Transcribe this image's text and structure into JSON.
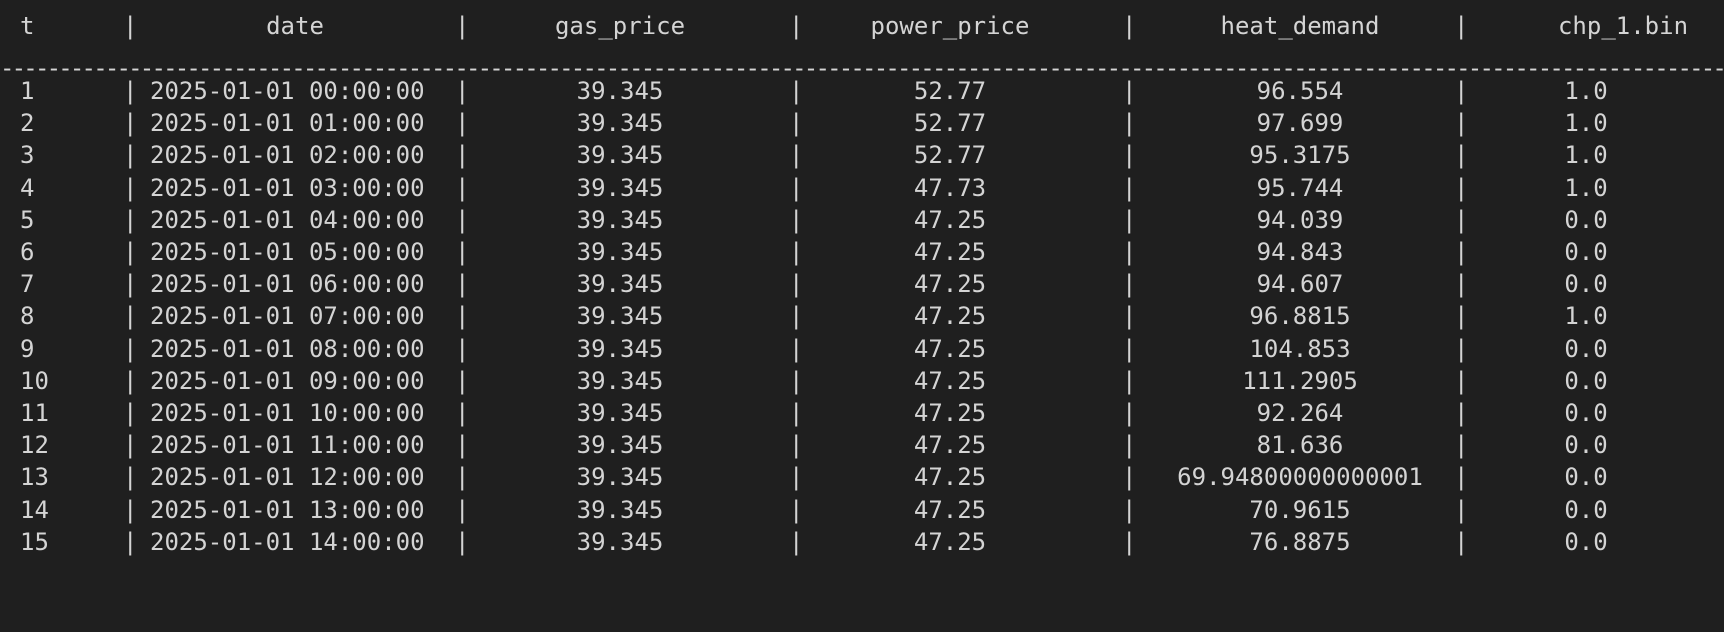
{
  "table": {
    "headers": {
      "t": "t",
      "date": "date",
      "gas_price": "gas_price",
      "power_price": "power_price",
      "heat_demand": "heat_demand",
      "chp_1_bin": "chp_1.bin"
    },
    "separator_char": "|",
    "divider": "----------------------------------------------------------------------------------------------------------------------------------------------------------------------------------------------------------------------------------------------------------------",
    "rows": [
      {
        "t": "1",
        "date": "2025-01-01 00:00:00",
        "gas_price": "39.345",
        "power_price": "52.77",
        "heat_demand": "96.554",
        "chp_1_bin": "1.0"
      },
      {
        "t": "2",
        "date": "2025-01-01 01:00:00",
        "gas_price": "39.345",
        "power_price": "52.77",
        "heat_demand": "97.699",
        "chp_1_bin": "1.0"
      },
      {
        "t": "3",
        "date": "2025-01-01 02:00:00",
        "gas_price": "39.345",
        "power_price": "52.77",
        "heat_demand": "95.3175",
        "chp_1_bin": "1.0"
      },
      {
        "t": "4",
        "date": "2025-01-01 03:00:00",
        "gas_price": "39.345",
        "power_price": "47.73",
        "heat_demand": "95.744",
        "chp_1_bin": "1.0"
      },
      {
        "t": "5",
        "date": "2025-01-01 04:00:00",
        "gas_price": "39.345",
        "power_price": "47.25",
        "heat_demand": "94.039",
        "chp_1_bin": "0.0"
      },
      {
        "t": "6",
        "date": "2025-01-01 05:00:00",
        "gas_price": "39.345",
        "power_price": "47.25",
        "heat_demand": "94.843",
        "chp_1_bin": "0.0"
      },
      {
        "t": "7",
        "date": "2025-01-01 06:00:00",
        "gas_price": "39.345",
        "power_price": "47.25",
        "heat_demand": "94.607",
        "chp_1_bin": "0.0"
      },
      {
        "t": "8",
        "date": "2025-01-01 07:00:00",
        "gas_price": "39.345",
        "power_price": "47.25",
        "heat_demand": "96.8815",
        "chp_1_bin": "1.0"
      },
      {
        "t": "9",
        "date": "2025-01-01 08:00:00",
        "gas_price": "39.345",
        "power_price": "47.25",
        "heat_demand": "104.853",
        "chp_1_bin": "0.0"
      },
      {
        "t": "10",
        "date": "2025-01-01 09:00:00",
        "gas_price": "39.345",
        "power_price": "47.25",
        "heat_demand": "111.2905",
        "chp_1_bin": "0.0"
      },
      {
        "t": "11",
        "date": "2025-01-01 10:00:00",
        "gas_price": "39.345",
        "power_price": "47.25",
        "heat_demand": "92.264",
        "chp_1_bin": "0.0"
      },
      {
        "t": "12",
        "date": "2025-01-01 11:00:00",
        "gas_price": "39.345",
        "power_price": "47.25",
        "heat_demand": "81.636",
        "chp_1_bin": "0.0"
      },
      {
        "t": "13",
        "date": "2025-01-01 12:00:00",
        "gas_price": "39.345",
        "power_price": "47.25",
        "heat_demand": "69.94800000000001",
        "chp_1_bin": "0.0"
      },
      {
        "t": "14",
        "date": "2025-01-01 13:00:00",
        "gas_price": "39.345",
        "power_price": "47.25",
        "heat_demand": "70.9615",
        "chp_1_bin": "0.0"
      },
      {
        "t": "15",
        "date": "2025-01-01 14:00:00",
        "gas_price": "39.345",
        "power_price": "47.25",
        "heat_demand": "76.8875",
        "chp_1_bin": "0.0"
      }
    ]
  },
  "colors": {
    "background": "#1f1f1f",
    "text": "#d4d4d4"
  }
}
